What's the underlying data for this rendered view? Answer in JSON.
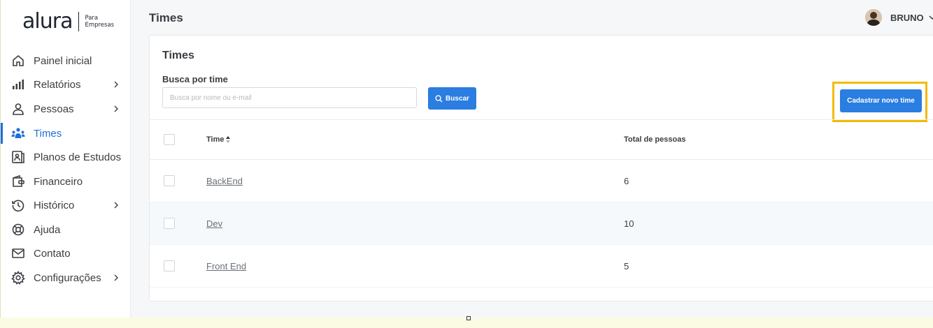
{
  "brand": {
    "name": "alura",
    "sub_line1": "Para",
    "sub_line2": "Empresas"
  },
  "sidebar": {
    "items": [
      {
        "label": "Painel inicial",
        "icon": "home-icon",
        "has_chevron": false,
        "active": false
      },
      {
        "label": "Relatórios",
        "icon": "bar-chart-icon",
        "has_chevron": true,
        "active": false
      },
      {
        "label": "Pessoas",
        "icon": "person-icon",
        "has_chevron": true,
        "active": false
      },
      {
        "label": "Times",
        "icon": "team-icon",
        "has_chevron": false,
        "active": true
      },
      {
        "label": "Planos de Estudos",
        "icon": "study-plan-icon",
        "has_chevron": false,
        "active": false
      },
      {
        "label": "Financeiro",
        "icon": "wallet-icon",
        "has_chevron": false,
        "active": false
      },
      {
        "label": "Histórico",
        "icon": "history-icon",
        "has_chevron": true,
        "active": false
      },
      {
        "label": "Ajuda",
        "icon": "lifebuoy-icon",
        "has_chevron": false,
        "active": false
      },
      {
        "label": "Contato",
        "icon": "mail-icon",
        "has_chevron": false,
        "active": false
      },
      {
        "label": "Configurações",
        "icon": "gear-icon",
        "has_chevron": true,
        "active": false
      }
    ]
  },
  "header": {
    "title": "Times",
    "user_name": "BRUNO"
  },
  "card": {
    "title": "Times",
    "search_label": "Busca por time",
    "search_placeholder": "Busca por nome ou e-mail",
    "search_value": "",
    "search_button": "Buscar",
    "new_button": "Cadastrar novo time"
  },
  "table": {
    "columns": [
      "Time",
      "Total de pessoas"
    ],
    "rows": [
      {
        "name": "BackEnd",
        "total": "6"
      },
      {
        "name": "Dev",
        "total": "10"
      },
      {
        "name": "Front End",
        "total": "5"
      }
    ]
  },
  "colors": {
    "accent": "#2a7de1",
    "highlight": "#f5b900",
    "active_nav": "#1f6fd8"
  }
}
